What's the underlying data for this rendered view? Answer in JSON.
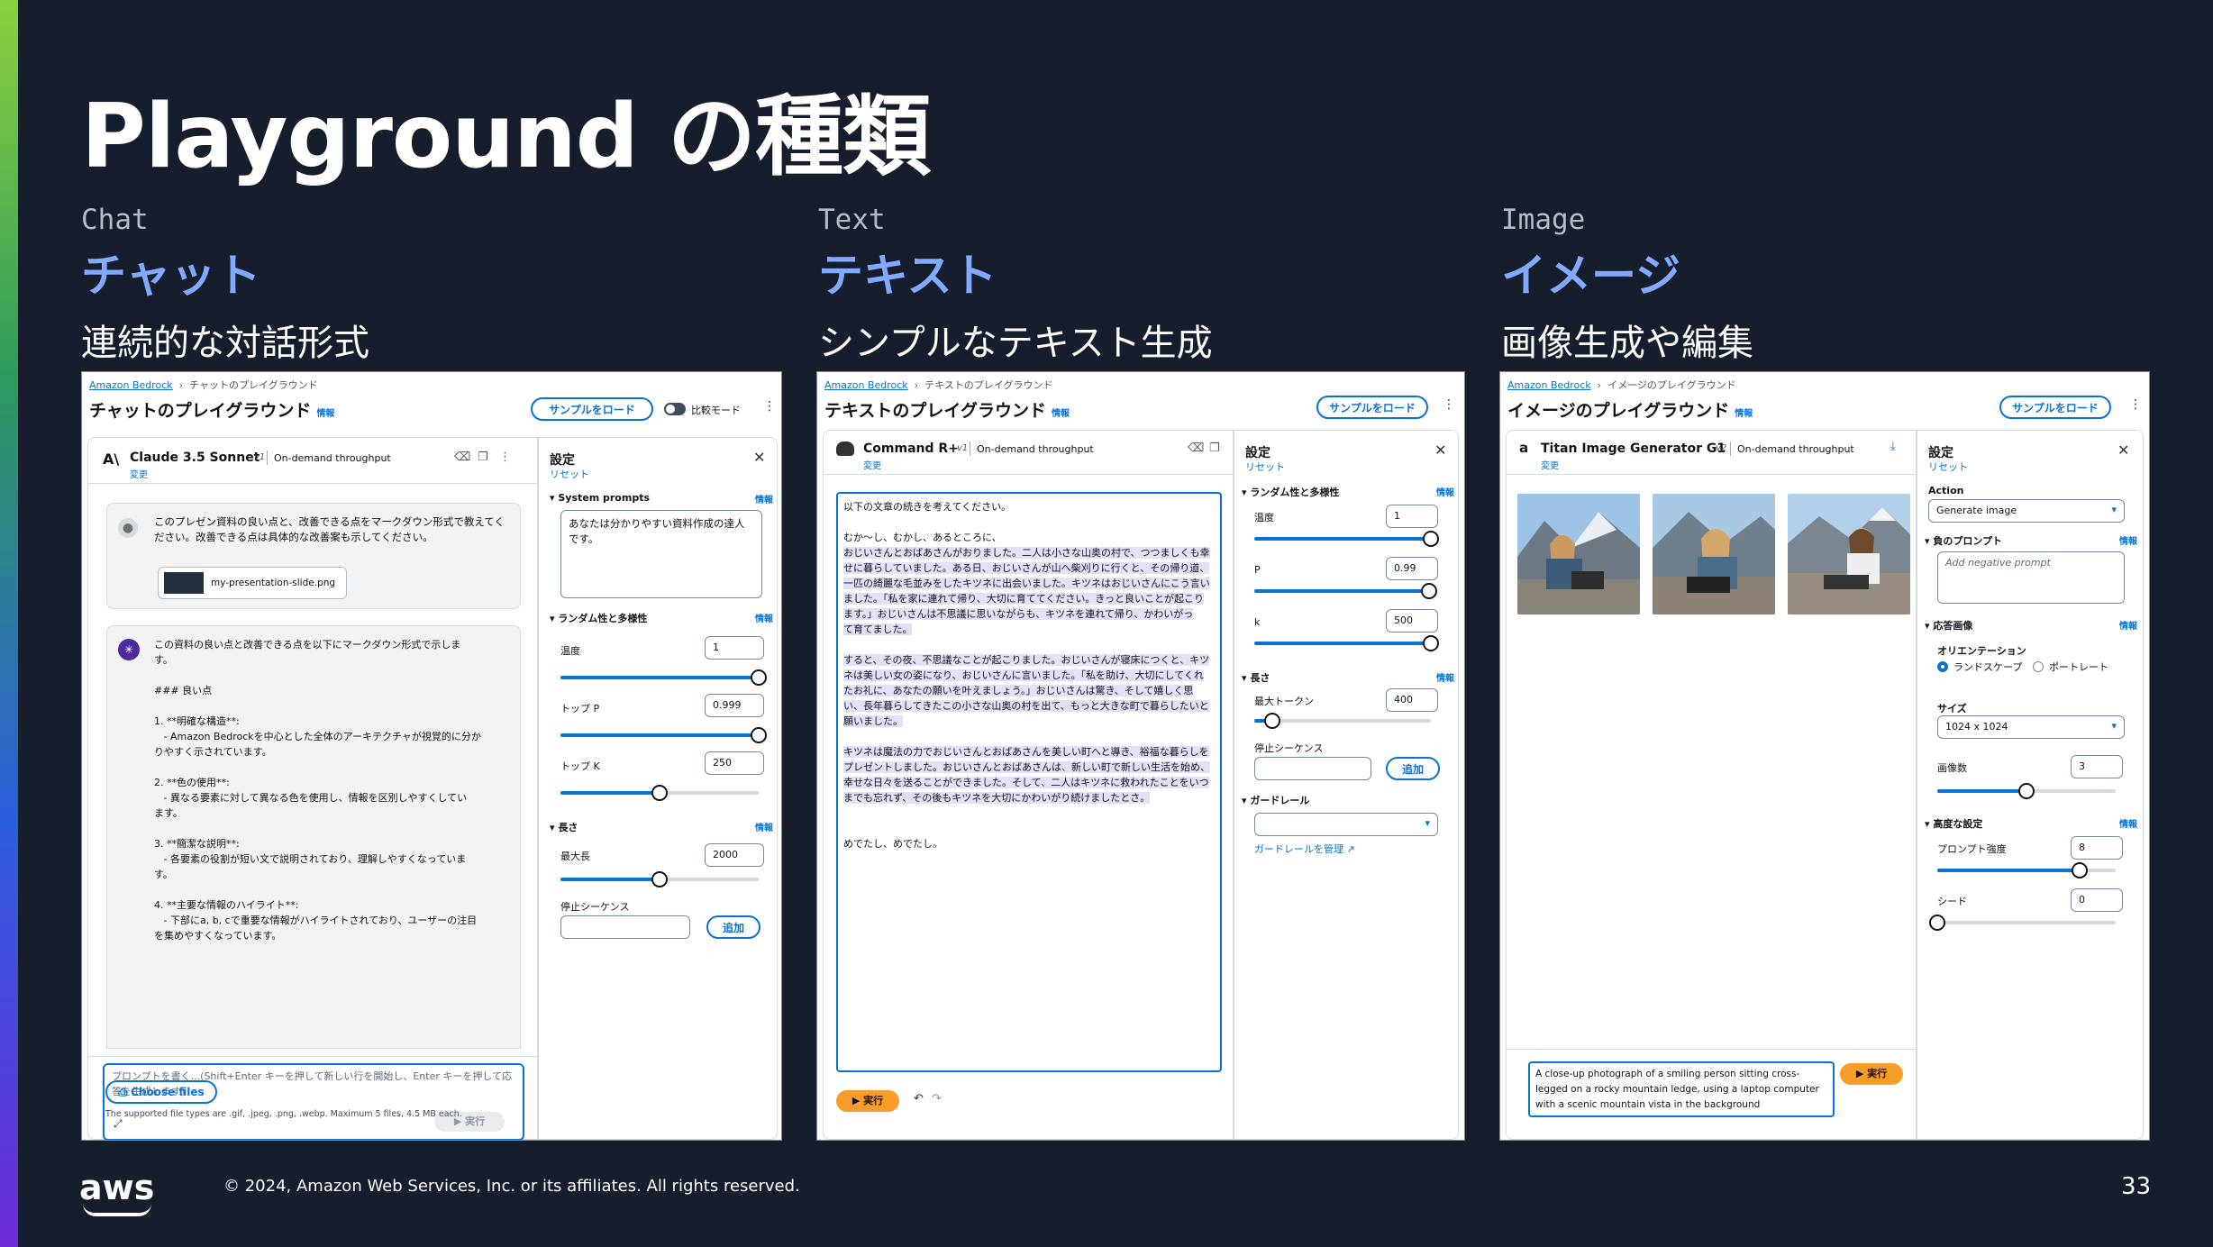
{
  "slide": {
    "title": "Playground の種類",
    "footer": "© 2024, Amazon Web Services, Inc. or its affiliates. All rights reserved.",
    "page_number": "33",
    "logo_text": "aws"
  },
  "columns": [
    {
      "en": "Chat",
      "jp": "チャット",
      "desc": "連続的な対話形式"
    },
    {
      "en": "Text",
      "jp": "テキスト",
      "desc": "シンプルなテキスト生成"
    },
    {
      "en": "Image",
      "jp": "イメージ",
      "desc": "画像生成や編集"
    }
  ],
  "chat": {
    "bc_root": "Amazon Bedrock",
    "bc_current": "チャットのプレイグラウンド",
    "title": "チャットのプレイグラウンド",
    "info": "情報",
    "load_sample": "サンプルをロード",
    "compare_mode": "比較モード",
    "model_name": "Claude 3.5 Sonnet",
    "model_version": "v1",
    "throughput": "On-demand throughput",
    "change": "変更",
    "user_msg": "このプレゼン資料の良い点と、改善できる点をマークダウン形式で教えてください。改善できる点は具体的な改善案も示してください。",
    "attachment": "my-presentation-slide.png",
    "reply_lines": [
      "この資料の良い点と改善できる点を以下にマークダウン形式で示しま",
      "す。",
      "",
      "### 良い点",
      "",
      "1. **明確な構造**:",
      "   - Amazon Bedrockを中心とした全体のアーキテクチャが視覚的に分か",
      "りやすく示されています。",
      "",
      "2. **色の使用**:",
      "   - 異なる要素に対して異なる色を使用し、情報を区別しやすくしてい",
      "ます。",
      "",
      "3. **簡潔な説明**:",
      "   - 各要素の役割が短い文で説明されており、理解しやすくなっていま",
      "す。",
      "",
      "4. **主要な情報のハイライト**:",
      "   - 下部にa, b, cで重要な情報がハイライトされており、ユーザーの注目",
      "を集めやすくなっています。"
    ],
    "prompt_placeholder": "プロンプトを書く...(Shift+Enter キーを押して新しい行を開始し、Enter キーを押して応答を生成します)",
    "run": "実行",
    "choose_files": "Choose files",
    "file_note": "The supported file types are .gif, .jpeg, .png, .webp. Maximum 5 files, 4.5 MB each.",
    "settings": "設定",
    "reset": "リセット",
    "system_prompts": "System prompts",
    "system_prompt_value": "あなたは分かりやすい資料作成の達人です。",
    "random_section": "ランダム性と多様性",
    "temp_label": "温度",
    "temp_value": "1",
    "temp_level": 1.0,
    "topp_label": "トップ P",
    "topp_value": "0.999",
    "topp_level": 0.999,
    "topk_label": "トップ K",
    "topk_value": "250",
    "topk_level": 0.5,
    "length_section": "長さ",
    "maxlen_label": "最大長",
    "maxlen_value": "2000",
    "maxlen_level": 0.5,
    "stop_label": "停止シーケンス",
    "add": "追加"
  },
  "text": {
    "bc_root": "Amazon Bedrock",
    "bc_current": "テキストのプレイグラウンド",
    "title": "テキストのプレイグラウンド",
    "info": "情報",
    "load_sample": "サンプルをロード",
    "model_name": "Command R+",
    "model_version": "v1",
    "throughput": "On-demand throughput",
    "change": "変更",
    "body_intro": "以下の文章の続きを考えてください。",
    "body_lines": [
      "むか～し、むかし、あるところに、",
      "おじいさんとおばあさんがおりました。二人は小さな山奥の村で、つつましくも幸",
      "せに暮らしていました。ある日、おじいさんが山へ柴刈りに行くと、その帰り道、",
      "一匹の綺麗な毛並みをしたキツネに出会いました。キツネはおじいさんにこう言い",
      "ました。「私を家に連れて帰り、大切に育ててください。きっと良いことが起こり",
      "ます。」おじいさんは不思議に思いながらも、キツネを連れて帰り、かわいがっ",
      "て育てました。",
      "",
      "すると、その夜、不思議なことが起こりました。おじいさんが寝床につくと、キツ",
      "ネは美しい女の姿になり、おじいさんに言いました。「私を助け、大切にしてくれ",
      "たお礼に、あなたの願いを叶えましょう。」おじいさんは驚き、そして嬉しく思",
      "い、長年暮らしてきたこの小さな山奥の村を出て、もっと大きな町で暮らしたいと",
      "願いました。",
      "",
      "キツネは魔法の力でおじいさんとおばあさんを美しい町へと導き、裕福な暮らしを",
      "プレゼントしました。おじいさんとおばあさんは、新しい町で新しい生活を始め、",
      "幸せな日々を送ることができました。そして、二人はキツネに救われたことをいつ",
      "までも忘れず、その後もキツネを大切にかわいがり続けましたとさ。"
    ],
    "body_end": "めでたし、めでたし。",
    "run": "実行",
    "settings": "設定",
    "reset": "リセット",
    "random_section": "ランダム性と多様性",
    "temp_label": "温度",
    "temp_value": "1",
    "temp_level": 1.0,
    "p_label": "P",
    "p_value": "0.99",
    "p_level": 0.99,
    "k_label": "k",
    "k_value": "500",
    "k_level": 1.0,
    "length_section": "長さ",
    "maxtok_label": "最大トークン",
    "maxtok_value": "400",
    "maxtok_level": 0.1,
    "stop_label": "停止シーケンス",
    "add": "追加",
    "guardrail_section": "ガードレール",
    "guardrail_manage": "ガードレールを管理"
  },
  "image": {
    "bc_root": "Amazon Bedrock",
    "bc_current": "イメージのプレイグラウンド",
    "title": "イメージのプレイグラウンド",
    "info": "情報",
    "load_sample": "サンプルをロード",
    "model_name": "Titan Image Generator G1",
    "model_version": "v2",
    "throughput": "On-demand throughput",
    "change": "変更",
    "prompt": "A close-up photograph of a smiling person sitting cross-legged on a rocky mountain ledge, using a laptop computer with a scenic mountain vista in the background",
    "run": "実行",
    "settings": "設定",
    "reset": "リセット",
    "action_label": "Action",
    "action_value": "Generate image",
    "neg_section": "負のプロンプト",
    "neg_placeholder": "Add negative prompt",
    "resp_section": "応答画像",
    "orientation_label": "オリエンテーション",
    "landscape": "ランドスケープ",
    "portrait": "ポートレート",
    "size_label": "サイズ",
    "size_value": "1024 x 1024",
    "count_label": "画像数",
    "count_value": "3",
    "count_level": 0.5,
    "adv_section": "高度な設定",
    "strength_label": "プロンプト強度",
    "strength_value": "8",
    "strength_level": 0.8,
    "seed_label": "シード",
    "seed_value": "0",
    "seed_level": 0.0
  },
  "colors": {
    "background": "#161d2d",
    "accent_blue": "#82aaff",
    "link": "#0972d3",
    "run_orange": "#f89c2a"
  }
}
